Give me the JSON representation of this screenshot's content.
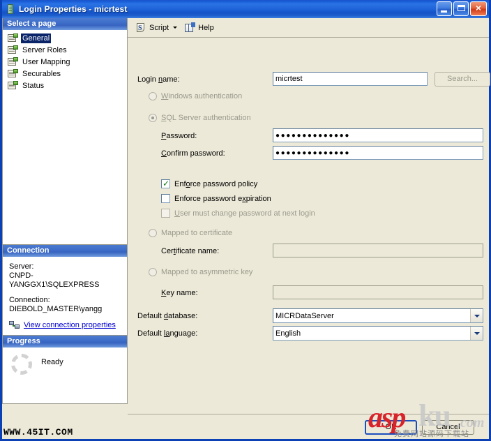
{
  "window": {
    "title_main": "Login Properties",
    "title_sep": " - ",
    "title_obj": "micrtest",
    "icon": "server-database-icon",
    "minimize_label": "Minimize",
    "maximize_label": "Maximize",
    "close_label": "Close"
  },
  "sidebar": {
    "pages_header": "Select a page",
    "pages": [
      {
        "label": "General",
        "selected": true
      },
      {
        "label": "Server Roles",
        "selected": false
      },
      {
        "label": "User Mapping",
        "selected": false
      },
      {
        "label": "Securables",
        "selected": false
      },
      {
        "label": "Status",
        "selected": false
      }
    ],
    "connection_header": "Connection",
    "server_label": "Server:",
    "server_value": "CNPD-YANGGX1\\SQLEXPRESS",
    "connection_label": "Connection:",
    "connection_value": "DIEBOLD_MASTER\\yangg",
    "view_connection_link": "View connection properties",
    "progress_header": "Progress",
    "progress_status": "Ready"
  },
  "toolbar": {
    "script_label": "Script",
    "script_icon": "script-icon",
    "script_dropdown_icon": "chevron-down-icon",
    "help_label": "Help",
    "help_icon": "help-book-icon"
  },
  "form": {
    "login_name_label": "Login name:",
    "login_name_value": "micrtest",
    "search_button": "Search...",
    "windows_auth_label": "Windows authentication",
    "sql_auth_label": "SQL Server authentication",
    "password_label": "Password:",
    "password_value": "●●●●●●●●●●●●●●",
    "confirm_password_label": "Confirm password:",
    "confirm_password_value": "●●●●●●●●●●●●●●",
    "enforce_policy_label": "Enforce password policy",
    "enforce_policy_checked": true,
    "enforce_expiration_label": "Enforce password expiration",
    "enforce_expiration_checked": false,
    "must_change_label": "User must change password at next login",
    "must_change_checked": false,
    "mapped_certificate_label": "Mapped to certificate",
    "certificate_name_label": "Certificate name:",
    "certificate_name_value": "",
    "mapped_asymmetric_label": "Mapped to asymmetric key",
    "key_name_label": "Key name:",
    "key_name_value": "",
    "default_database_label": "Default database:",
    "default_database_value": "MICRDataServer",
    "default_language_label": "Default language:",
    "default_language_value": "English"
  },
  "buttons": {
    "ok": "OK",
    "cancel": "Cancel"
  },
  "watermark": {
    "site_bottom_left": "WWW.45IT.COM",
    "brand_red": "asp",
    "brand_grey": "ku",
    "brand_tld": ".com",
    "tagline": "免费网站源码下载站"
  },
  "colors": {
    "title_blue": "#1b53c8",
    "dialog_face": "#ece9d8",
    "panel_header_blue": "#3d6ec9",
    "selection_blue": "#0a246a",
    "link_blue": "#0000cc",
    "brand_red": "#d8232a"
  }
}
